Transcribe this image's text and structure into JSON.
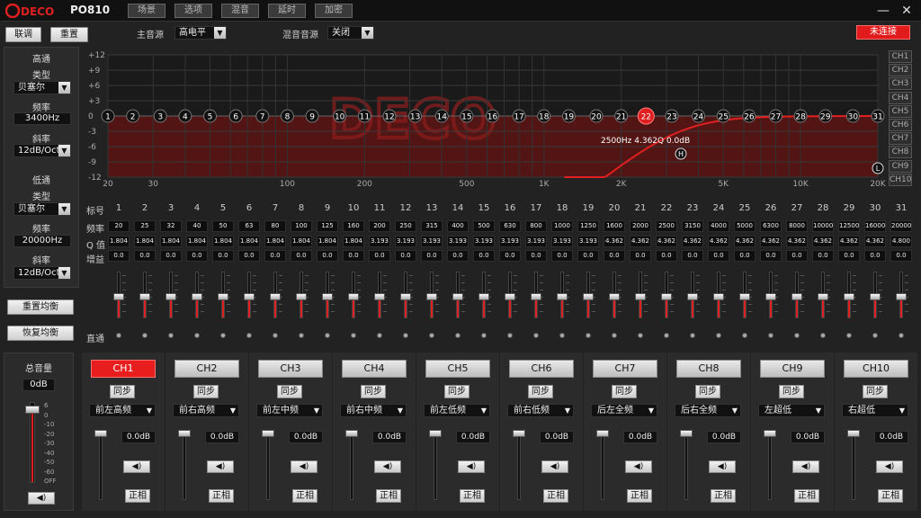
{
  "window": {
    "app_title": "PO810",
    "logo_text": "DECO",
    "tabs": [
      "场景",
      "选项",
      "混音",
      "延时",
      "加密"
    ],
    "minimize": "—",
    "close": "✕"
  },
  "toolbar": {
    "link_label": "联调",
    "reset_label": "重置",
    "main_source_label": "主音源",
    "main_source_value": "高电平",
    "mix_source_label": "混音音源",
    "mix_source_value": "关闭",
    "status_button": "未连接"
  },
  "highpass": {
    "title": "高通",
    "type_label": "类型",
    "type_value": "贝塞尔",
    "freq_label": "频率",
    "freq_value": "3400Hz",
    "slope_label": "斜率",
    "slope_value": "12dB/Oct"
  },
  "lowpass": {
    "title": "低通",
    "type_label": "类型",
    "type_value": "贝塞尔",
    "freq_label": "频率",
    "freq_value": "20000Hz",
    "slope_label": "斜率",
    "slope_value": "12dB/Oct"
  },
  "eq_buttons": {
    "reset_eq": "重置均衡",
    "restore_eq": "恢复均衡"
  },
  "graph": {
    "y_ticks": [
      "+12",
      "+9",
      "+6",
      "+3",
      "0",
      "-3",
      "-6",
      "-9",
      "-12"
    ],
    "x_ticks": [
      "20",
      "30",
      "100",
      "200",
      "500",
      "1K",
      "2K",
      "5K",
      "10K",
      "20K"
    ],
    "tooltip": "2500Hz  4.362Q  0.0dB",
    "marker_h": "H",
    "marker_l": "L",
    "channels": [
      "CH1",
      "CH2",
      "CH3",
      "CH4",
      "CH5",
      "CH6",
      "CH7",
      "CH8",
      "CH9",
      "CH10"
    ],
    "selected_band": 22,
    "accent": "#e02020"
  },
  "table": {
    "row_labels": {
      "index": "标号",
      "freq": "频率",
      "q": "Q 值",
      "gain": "增益",
      "bypass": "直通"
    },
    "index": [
      "1",
      "2",
      "3",
      "4",
      "5",
      "6",
      "7",
      "8",
      "9",
      "10",
      "11",
      "12",
      "13",
      "14",
      "15",
      "16",
      "17",
      "18",
      "19",
      "20",
      "21",
      "22",
      "23",
      "24",
      "25",
      "26",
      "27",
      "28",
      "29",
      "30",
      "31"
    ],
    "freq": [
      "20",
      "25",
      "32",
      "40",
      "50",
      "63",
      "80",
      "100",
      "125",
      "160",
      "200",
      "250",
      "315",
      "400",
      "500",
      "630",
      "800",
      "1000",
      "1250",
      "1600",
      "2000",
      "2500",
      "3150",
      "4000",
      "5000",
      "6300",
      "8000",
      "10000",
      "12500",
      "16000",
      "20000"
    ],
    "q": [
      "1.804",
      "1.804",
      "1.804",
      "1.804",
      "1.804",
      "1.804",
      "1.804",
      "1.804",
      "1.804",
      "1.804",
      "3.193",
      "3.193",
      "3.193",
      "3.193",
      "3.193",
      "3.193",
      "3.193",
      "3.193",
      "3.193",
      "4.362",
      "4.362",
      "4.362",
      "4.362",
      "4.362",
      "4.362",
      "4.362",
      "4.362",
      "4.362",
      "4.362",
      "4.362",
      "4.800"
    ],
    "gain": [
      "0.0",
      "0.0",
      "0.0",
      "0.0",
      "0.0",
      "0.0",
      "0.0",
      "0.0",
      "0.0",
      "0.0",
      "0.0",
      "0.0",
      "0.0",
      "0.0",
      "0.0",
      "0.0",
      "0.0",
      "0.0",
      "0.0",
      "0.0",
      "0.0",
      "0.0",
      "0.0",
      "0.0",
      "0.0",
      "0.0",
      "0.0",
      "0.0",
      "0.0",
      "0.0",
      "0.0"
    ]
  },
  "master": {
    "title": "总音量",
    "value": "0dB",
    "scale": [
      "6",
      "0",
      "-10",
      "-20",
      "-30",
      "-40",
      "-50",
      "-60",
      "OFF"
    ]
  },
  "channels": [
    {
      "name": "CH1",
      "sync": "同步",
      "position": "前左高频",
      "db": "0.0dB",
      "phase": "正相",
      "active": true
    },
    {
      "name": "CH2",
      "sync": "同步",
      "position": "前右高频",
      "db": "0.0dB",
      "phase": "正相",
      "active": false
    },
    {
      "name": "CH3",
      "sync": "同步",
      "position": "前左中频",
      "db": "0.0dB",
      "phase": "正相",
      "active": false
    },
    {
      "name": "CH4",
      "sync": "同步",
      "position": "前右中频",
      "db": "0.0dB",
      "phase": "正相",
      "active": false
    },
    {
      "name": "CH5",
      "sync": "同步",
      "position": "前左低频",
      "db": "0.0dB",
      "phase": "正相",
      "active": false
    },
    {
      "name": "CH6",
      "sync": "同步",
      "position": "前右低频",
      "db": "0.0dB",
      "phase": "正相",
      "active": false
    },
    {
      "name": "CH7",
      "sync": "同步",
      "position": "后左全频",
      "db": "0.0dB",
      "phase": "正相",
      "active": false
    },
    {
      "name": "CH8",
      "sync": "同步",
      "position": "后右全频",
      "db": "0.0dB",
      "phase": "正相",
      "active": false
    },
    {
      "name": "CH9",
      "sync": "同步",
      "position": "左超低",
      "db": "0.0dB",
      "phase": "正相",
      "active": false
    },
    {
      "name": "CH10",
      "sync": "同步",
      "position": "右超低",
      "db": "0.0dB",
      "phase": "正相",
      "active": false
    }
  ]
}
